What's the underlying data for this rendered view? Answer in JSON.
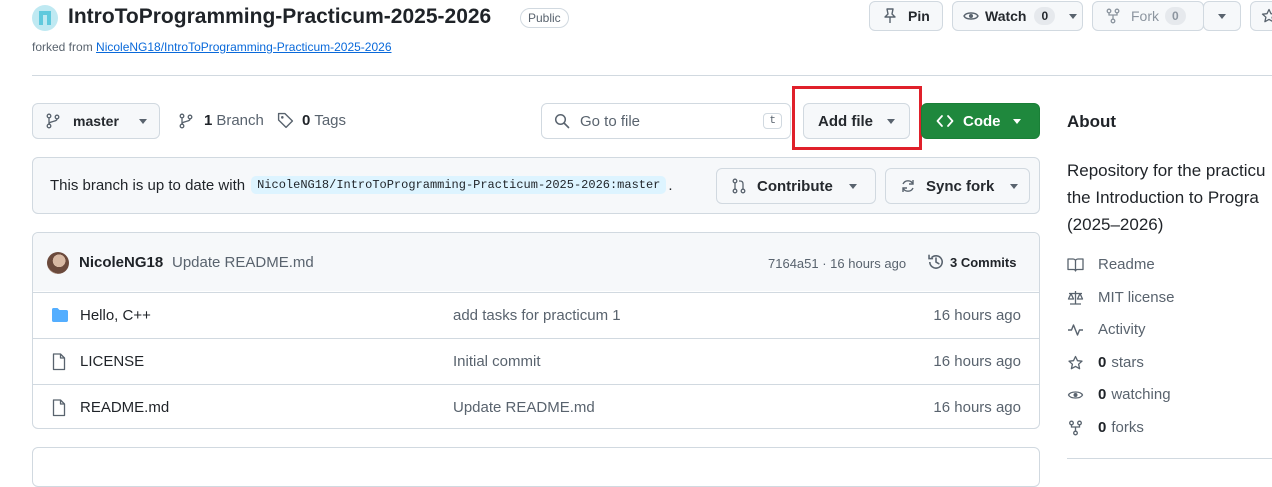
{
  "repo": {
    "name": "IntroToProgramming-Practicum-2025-2026",
    "visibility": "Public",
    "forked_prefix": "forked from",
    "forked_from": "NicoleNG18/IntroToProgramming-Practicum-2025-2026"
  },
  "actions": {
    "pin": "Pin",
    "watch": "Watch",
    "watch_count": "0",
    "fork": "Fork",
    "fork_count": "0"
  },
  "toolbar": {
    "branch": "master",
    "branches_count": "1",
    "branches_label": "Branch",
    "tags_count": "0",
    "tags_label": "Tags",
    "search_placeholder": "Go to file",
    "search_shortcut": "t",
    "add_file": "Add file",
    "code": "Code"
  },
  "sync": {
    "text": "This branch is up to date with",
    "ref": "NicoleNG18/IntroToProgramming-Practicum-2025-2026:master",
    "period": ".",
    "contribute": "Contribute",
    "sync_fork": "Sync fork"
  },
  "commit": {
    "author": "NicoleNG18",
    "message": "Update README.md",
    "hash_time": "7164a51 · 16 hours ago",
    "commits_label": "3 Commits"
  },
  "files": [
    {
      "name": "Hello, C++",
      "type": "folder",
      "message": "add tasks for practicum 1",
      "age": "16 hours ago"
    },
    {
      "name": "LICENSE",
      "type": "file",
      "message": "Initial commit",
      "age": "16 hours ago"
    },
    {
      "name": "README.md",
      "type": "file",
      "message": "Update README.md",
      "age": "16 hours ago"
    }
  ],
  "about": {
    "title": "About",
    "description_lines": [
      "Repository for the practicu",
      "the Introduction to Progra",
      "(2025–2026)"
    ],
    "readme": "Readme",
    "license": "MIT license",
    "activity": "Activity",
    "stars_count": "0",
    "stars_label": "stars",
    "watching_count": "0",
    "watching_label": "watching",
    "forks_count": "0",
    "forks_label": "forks"
  },
  "colors": {
    "accent_green": "#1f883d",
    "link_blue": "#0969da",
    "highlight_red": "#e0202a",
    "folder_blue": "#54aeff"
  }
}
